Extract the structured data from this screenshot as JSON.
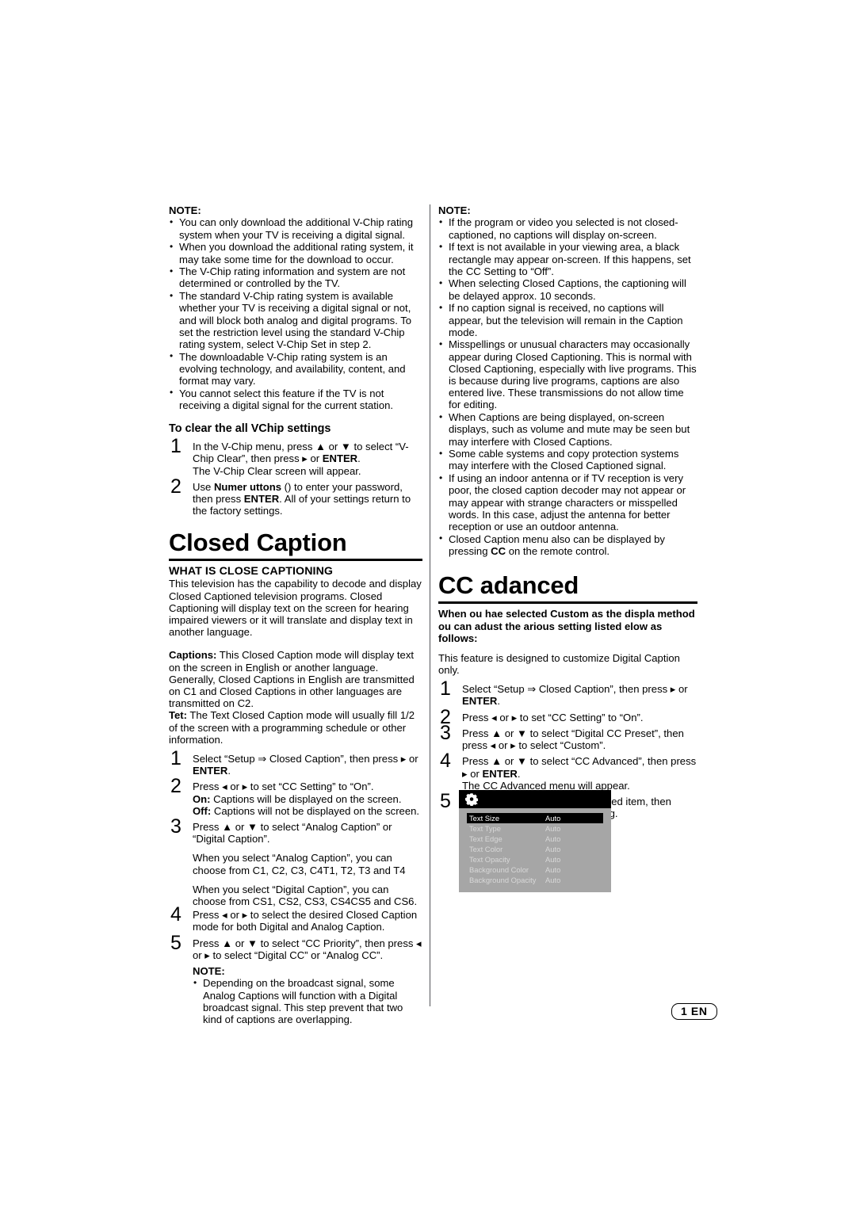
{
  "page": {
    "footer_label": "1 EN"
  },
  "left_column": {
    "note_label": "NOTE:",
    "notes": [
      "You can only download the additional V-Chip rating system when your TV is receiving a digital signal.",
      "When you download the additional rating system, it may take some time for the download to occur.",
      "The V-Chip rating information and system are not determined or controlled by the TV.",
      "The standard V-Chip rating system is available whether your TV is receiving a digital signal or not, and will block both analog and digital programs. To set the restriction level using the standard V-Chip rating system, select V-Chip Set in step 2.",
      "The downloadable V-Chip rating system is an evolving technology, and availability, content, and format may vary.",
      "You cannot select this feature if the TV is not receiving a digital signal for the current station."
    ],
    "clear_heading": "To clear the all VChip settings",
    "clear_steps": [
      {
        "num": "1",
        "html": "In the V-Chip menu, press ▲ or ▼ to select “V-Chip Clear”, then press ▸ or <b>ENTER</b>.<br>The V-Chip Clear screen will appear."
      },
      {
        "num": "2",
        "html": "Use <b>Numer uttons</b> () to enter your password, then press <b>ENTER</b>. All of your settings return to the factory settings."
      }
    ],
    "section_title": "Closed Caption",
    "what_is_heading": "WHAT IS CLOSE CAPTIONING",
    "what_is_body": "This television has the capability to decode and display Closed Captioned television programs. Closed Captioning will display text on the screen for hearing impaired viewers or it will translate and display text in another language.",
    "captions_html": "<b>Captions:</b> This Closed Caption mode will display text on the screen in English or another language. Generally, Closed Captions in English are transmitted on C1 and Closed Captions in other languages are transmitted on C2.",
    "text_html": "<b>Tet:</b> The Text Closed Caption mode will usually fill 1/2 of the screen with a programming schedule or other information.",
    "cc_steps": [
      {
        "num": "1",
        "html": "Select “Setup ⇒ Closed Caption”, then press ▸ or <b>ENTER</b>."
      },
      {
        "num": "2",
        "html": "Press ◂ or ▸ to set “CC Setting” to “On”.<br><b>On:</b> Captions will be displayed on the screen.<br><b>Off:</b> Captions will not be displayed on the screen."
      },
      {
        "num": "3",
        "html": "Press ▲ or ▼ to select “Analog Caption” or “Digital Caption”."
      }
    ],
    "analog_note": "When you select “Analog Caption”, you can choose from C1, C2, C3, C4T1, T2, T3 and T4",
    "digital_note": "When you select “Digital Caption”, you can choose from CS1, CS2, CS3, CS4CS5 and CS6.",
    "cc_steps_2": [
      {
        "num": "4",
        "html": "Press ◂ or ▸ to select the desired Closed Caption mode for both Digital and Analog Caption."
      },
      {
        "num": "5",
        "html": "Press ▲ or ▼ to select “CC Priority”, then press ◂ or ▸ to select “Digital CC” or “Analog CC”."
      }
    ],
    "bottom_note_label": "NOTE:",
    "bottom_notes": [
      "Depending on the broadcast signal, some Analog Captions will function with a Digital broadcast signal. This step prevent that two kind of captions are overlapping."
    ]
  },
  "right_column": {
    "note_label": "NOTE:",
    "notes": [
      "If the program or video you selected is not closed-captioned, no captions will display on-screen.",
      "If text is not available in your viewing area, a black rectangle may appear on-screen. If this happens, set the CC Setting to “Off”.",
      "When selecting Closed Captions, the captioning will be delayed approx. 10 seconds.",
      "If no caption signal is received, no captions will appear, but the television will remain in the Caption mode.",
      "Misspellings or unusual characters may occasionally appear during Closed Captioning. This is normal with Closed Captioning, especially with live programs. This is because during live programs, captions are also entered live. These transmissions do not allow time for editing.",
      "When Captions are being displayed, on-screen displays, such as volume and mute may be seen but may interfere with Closed Captions.",
      "Some cable systems and copy protection systems may interfere with the Closed Captioned signal.",
      "If using an indoor antenna or if TV reception is very poor, the closed caption decoder may not appear or may appear with strange characters or misspelled words. In this case, adjust the antenna for better reception or use an outdoor antenna."
    ],
    "notes_last_html": "Closed Caption menu also can be displayed by pressing <b>CC</b> on the remote control.",
    "section_title": "CC adanced",
    "intro_bold": "When ou hae selected Custom as the displa method ou can adust the arious setting listed elow as follows:",
    "intro_body": "This feature is designed to customize Digital Caption only.",
    "steps": [
      {
        "num": "1",
        "html": "Select “Setup ⇒ Closed Caption”, then press ▸ or <b>ENTER</b>."
      },
      {
        "num": "2",
        "html": "Press ◂ or ▸ to set “CC Setting” to “On”."
      },
      {
        "num": "3",
        "html": "Press ▲ or ▼ to select “Digital CC Preset”, then press ◂ or ▸ to select “Custom”."
      },
      {
        "num": "4",
        "html": "Press ▲ or ▼ to select “CC Advanced”, then press ▸ or <b>ENTER</b>.<br>The CC Advanced menu will appear."
      },
      {
        "num": "5",
        "html": "Press ▲ or ▼ to select the desired item, then press ◂ or ▸ to change the setting."
      }
    ]
  },
  "osd_menu": {
    "icon": "gear-icon",
    "colors": {
      "titlebar": "#000000",
      "body": "#a6a6a6",
      "selected_row": "#000000",
      "row_text": "#d8d8d8",
      "selected_text": "#ffffff"
    },
    "rows": [
      {
        "label": "Text Size",
        "value": "Auto",
        "selected": true
      },
      {
        "label": "Text Type",
        "value": "Auto",
        "selected": false
      },
      {
        "label": "Text Edge",
        "value": "Auto",
        "selected": false
      },
      {
        "label": "Text Color",
        "value": "Auto",
        "selected": false
      },
      {
        "label": "Text Opacity",
        "value": "Auto",
        "selected": false
      },
      {
        "label": "Background Color",
        "value": "Auto",
        "selected": false
      },
      {
        "label": "Background Opacity",
        "value": "Auto",
        "selected": false
      }
    ]
  }
}
